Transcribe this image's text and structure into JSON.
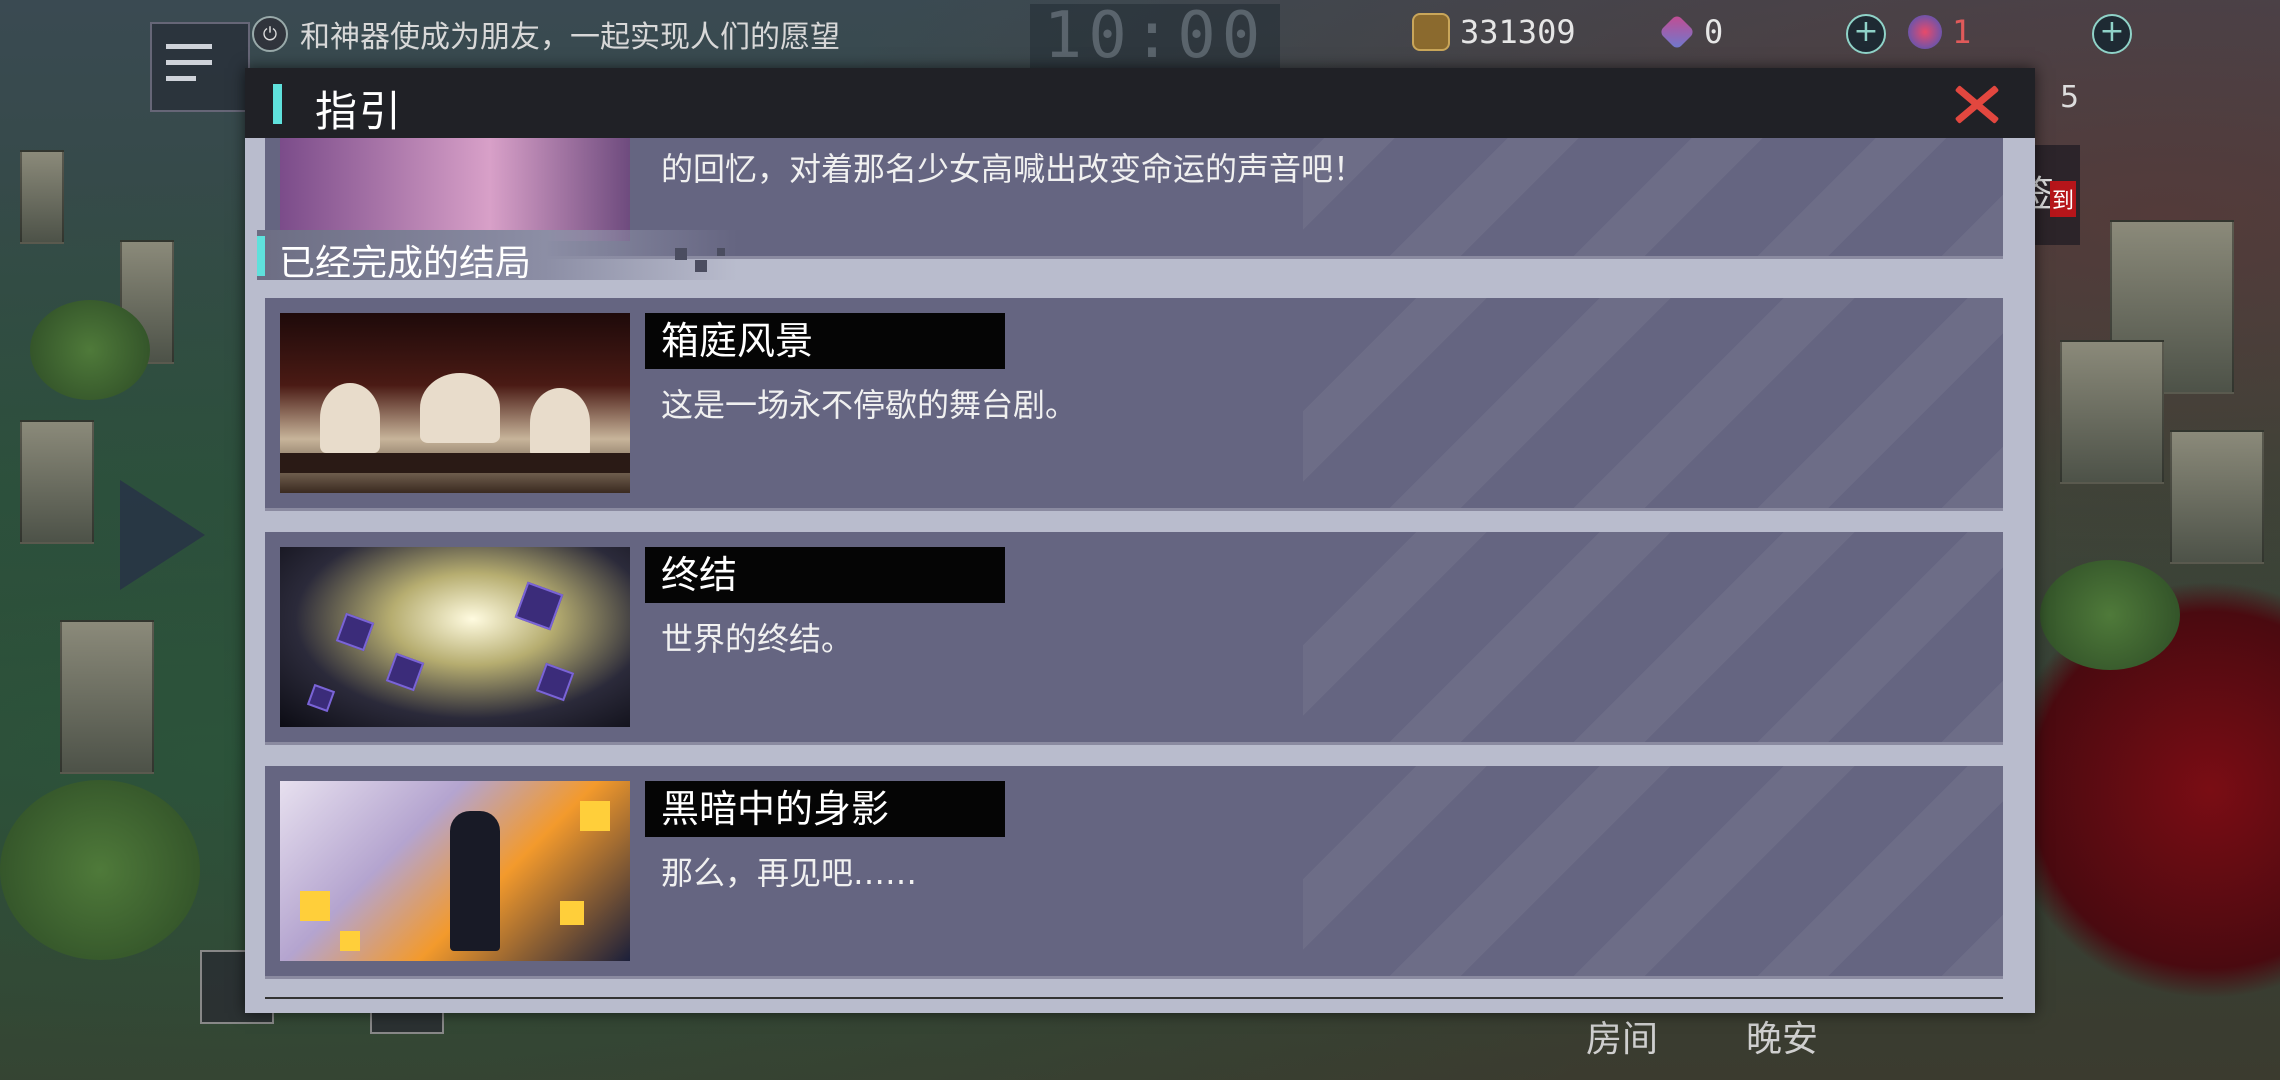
{
  "hud": {
    "notice": "和神器使成为朋友，一起实现人们的愿望",
    "clock": "10:00",
    "currency": "331309",
    "gems": "0",
    "tickets": "1",
    "right_count": "5"
  },
  "background": {
    "signin_label": "签",
    "signin_badge": "到",
    "room_label": "房间",
    "goodnight_label": "晚安"
  },
  "modal": {
    "title": "指引",
    "partial_desc": "的回忆，对着那名少女高喊出改变命运的声音吧！",
    "section_title": "已经完成的结局",
    "endings": [
      {
        "name": "箱庭风景",
        "desc": "这是一场永不停歇的舞台剧。"
      },
      {
        "name": "终结",
        "desc": "世界的终结。"
      },
      {
        "name": "黑暗中的身影",
        "desc": "那么，再见吧……"
      }
    ]
  },
  "colors": {
    "accent": "#5fe1dc",
    "close": "#e2473f",
    "card": "#656581",
    "panel": "#b9bccd",
    "header": "#202126"
  }
}
